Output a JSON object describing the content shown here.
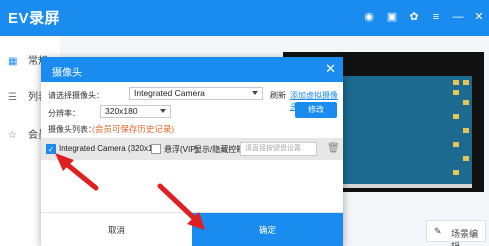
{
  "app": {
    "title": "EV录屏"
  },
  "titlebar_icons": [
    "user-icon",
    "clipboard-icon",
    "settings-icon",
    "menu-icon",
    "minimize-icon",
    "close-icon"
  ],
  "sidebar": {
    "items": [
      {
        "label": "常规",
        "icon": "grid-icon"
      },
      {
        "label": "列表",
        "icon": "list-icon"
      },
      {
        "label": "会员",
        "icon": "star-icon"
      }
    ]
  },
  "scene_edit": {
    "label": "场景编辑"
  },
  "dialog": {
    "title": "摄像头",
    "close": "✕",
    "select_camera_label": "请选择摄像头：",
    "camera_value": "Integrated Camera",
    "refresh": "刷新",
    "add_virtual_link": "添加虚拟摄像头",
    "resolution_label": "分辨率：",
    "resolution_value": "320x180",
    "modify": "修改",
    "camera_list_label": "摄像头列表：",
    "vip_note": "(会员可保存历史记录)",
    "row": {
      "camera_checked": true,
      "camera_name": "Integrated Camera (320x1",
      "float_checked": false,
      "float_label": "悬浮(VIP)",
      "toggle_label": "显示/隐藏控制",
      "hotkey_placeholder": "请直接按键盘设置"
    },
    "cancel": "取消",
    "confirm": "确定"
  },
  "colors": {
    "accent": "#1a8cf0",
    "note": "#e8662c",
    "arrow": "#e02020"
  }
}
